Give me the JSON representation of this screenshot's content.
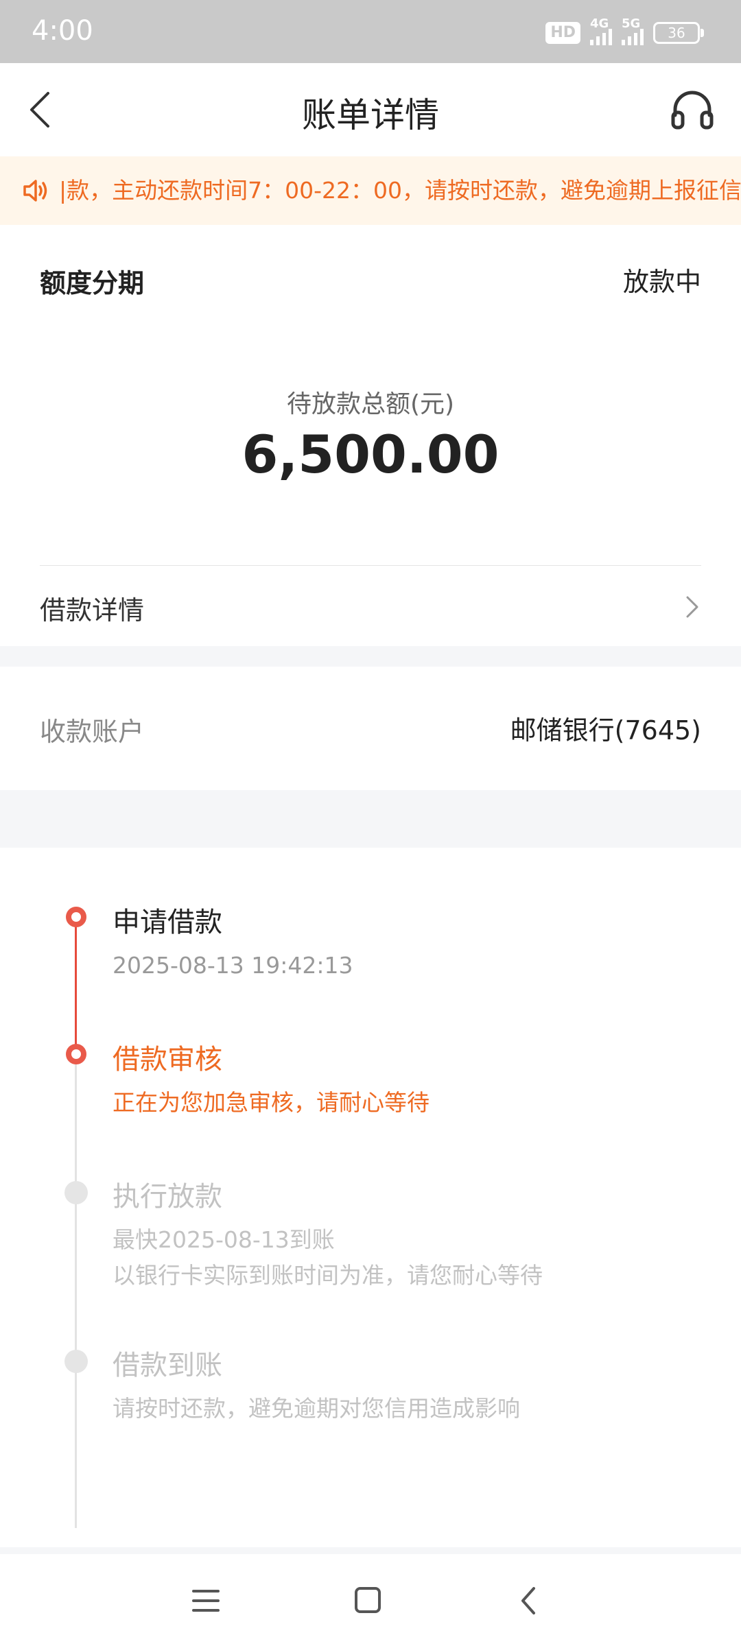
{
  "status_bar": {
    "time": "4:00",
    "hd_badge": "HD",
    "net1": "4G",
    "net2": "5G",
    "battery": "36"
  },
  "header": {
    "title": "账单详情"
  },
  "notice": {
    "text": "|款，主动还款时间7：00-22：00，请按时还款，避免逾期上报征信，"
  },
  "loan": {
    "product": "额度分期",
    "status": "放款中",
    "amount_label": "待放款总额(元)",
    "amount": "6,500.00",
    "detail_label": "借款详情"
  },
  "account": {
    "label": "收款账户",
    "value": "邮储银行(7645)"
  },
  "timeline": [
    {
      "title": "申请借款",
      "lines": [
        "2025-08-13 19:42:13"
      ]
    },
    {
      "title": "借款审核",
      "lines": [
        "正在为您加急审核，请耐心等待"
      ]
    },
    {
      "title": "执行放款",
      "lines": [
        "最快2025-08-13到账",
        "以银行卡实际到账时间为准，请您耐心等待"
      ]
    },
    {
      "title": "借款到账",
      "lines": [
        "请按时还款，避免逾期对您信用造成影响"
      ]
    }
  ],
  "colors": {
    "accent": "#ee6a22",
    "timeline_red": "#e64a3b",
    "notice_bg": "#fff6ea"
  },
  "icons": [
    "back-arrow-icon",
    "headset-icon",
    "speaker-icon",
    "chevron-right-icon",
    "menu-icon",
    "home-square-icon",
    "nav-back-icon"
  ]
}
